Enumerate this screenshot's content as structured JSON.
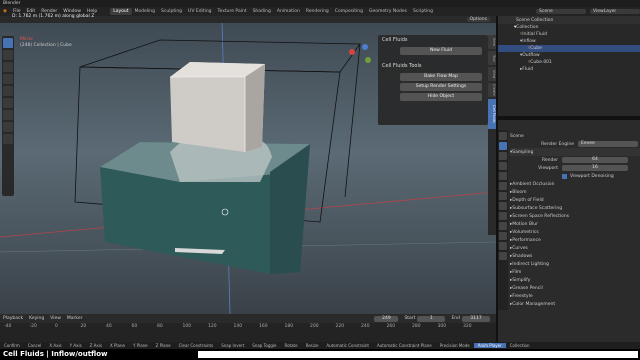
{
  "window": {
    "title": "Blender"
  },
  "menus": [
    "File",
    "Edit",
    "Render",
    "Window",
    "Help"
  ],
  "workspaces": [
    "Layout",
    "Modeling",
    "Sculpting",
    "UV Editing",
    "Texture Paint",
    "Shading",
    "Animation",
    "Rendering",
    "Compositing",
    "Geometry Nodes",
    "Scripting"
  ],
  "scene": {
    "name": "Scene",
    "view_layer": "ViewLayer"
  },
  "viewport": {
    "status_text": "D: 1.762 m (1.762 m) along global Z",
    "info_line1": "Mirror",
    "info_line2": "(248) Collection | Cube",
    "options_label": "Options"
  },
  "cell_fluids_panel": {
    "section1": "Cell Fluids",
    "new_fluid": "New Fluid",
    "section2": "Cell Fluids Tools",
    "bake_flow_map": "Bake Flow Map",
    "setup_render": "Setup Render Settings",
    "hide_object": "Hide Object"
  },
  "side_tabs": [
    "Item",
    "Tool",
    "View",
    "Create",
    "Cell Fluids"
  ],
  "outliner": {
    "header": "Scene Collection",
    "rows": [
      "Collection",
      "Initial Fluid",
      "Inflow",
      "Cube",
      "Outflow",
      "Cube.001",
      "Fluid"
    ]
  },
  "properties": {
    "scene_label": "Scene",
    "render_engine_label": "Render Engine",
    "render_engine": "Eevee",
    "sampling": "Sampling",
    "render_label": "Render",
    "render_val": "64",
    "viewport_label": "Viewport",
    "viewport_val": "16",
    "denoise": "Viewport Denoising",
    "sections": [
      "Ambient Occlusion",
      "Bloom",
      "Depth of Field",
      "Subsurface Scattering",
      "Screen Space Reflections",
      "Motion Blur",
      "Volumetrics",
      "Performance",
      "Curves",
      "Shadows",
      "Indirect Lighting",
      "Film",
      "Simplify",
      "Grease Pencil",
      "Freestyle",
      "Color Management"
    ]
  },
  "timeline": {
    "menu": [
      "Playback",
      "Keying",
      "View",
      "Marker"
    ],
    "current": "249",
    "start_label": "Start",
    "start": "1",
    "end_label": "End",
    "end": "3117",
    "ticks": [
      "-40",
      "-20",
      "0",
      "20",
      "40",
      "60",
      "80",
      "100",
      "120",
      "140",
      "160",
      "180",
      "200",
      "220",
      "240",
      "260",
      "280",
      "300",
      "320"
    ]
  },
  "statusbar": [
    "Confirm",
    "Cancel",
    "X Axis",
    "Y Axis",
    "Z Axis",
    "X Plane",
    "Y Plane",
    "Z Plane",
    "Clear Constraints",
    "Snap Invert",
    "Snap Toggle",
    "Rotate",
    "Resize",
    "Automatic Constraint",
    "Automatic Constraint Plane",
    "Precision Mode",
    "Anim Player",
    "Collection"
  ],
  "caption": "Cell Fluids | Inflow/outflow"
}
